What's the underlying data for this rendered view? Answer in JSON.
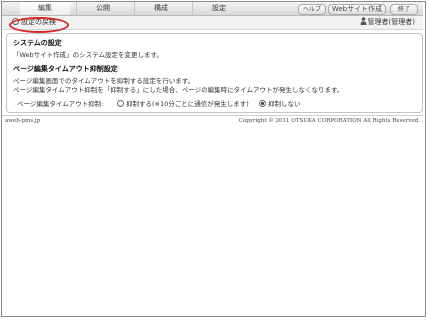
{
  "menu": {
    "tabs": [
      {
        "label": "編集"
      },
      {
        "label": "公開"
      },
      {
        "label": "構成"
      },
      {
        "label": "設定"
      }
    ],
    "help": "ヘルプ",
    "site_create": "Webサイト作成",
    "exit": "終了"
  },
  "subbar": {
    "settings_link": "設定の戻検",
    "user": "管理者(管理者)"
  },
  "panel": {
    "system_title": "システムの設定",
    "system_desc": "「Webサイト作成」のシステム設定を変更します。",
    "timeout_title": "ページ編集タイムアウト抑制設定",
    "timeout_desc1": "ページ編集画面でのタイムアウトを抑制する設定を行います。",
    "timeout_desc2": "ページ編集タイムアウト抑制を「抑制する」にした場合、ページの編集時にタイムアウトが発生しなくなります。",
    "option_label": "ページ編集タイムアウト抑制:",
    "option_on": "抑制する(※10分ごとに通信が発生します)",
    "option_off": "抑制しない"
  },
  "footer": {
    "left": "aweb-pms.jp",
    "right": "Copyright © 2011 OTSUKA CORPORATION All Rights Reserved."
  },
  "colors": {
    "highlight_ring": "#d42a2a"
  }
}
